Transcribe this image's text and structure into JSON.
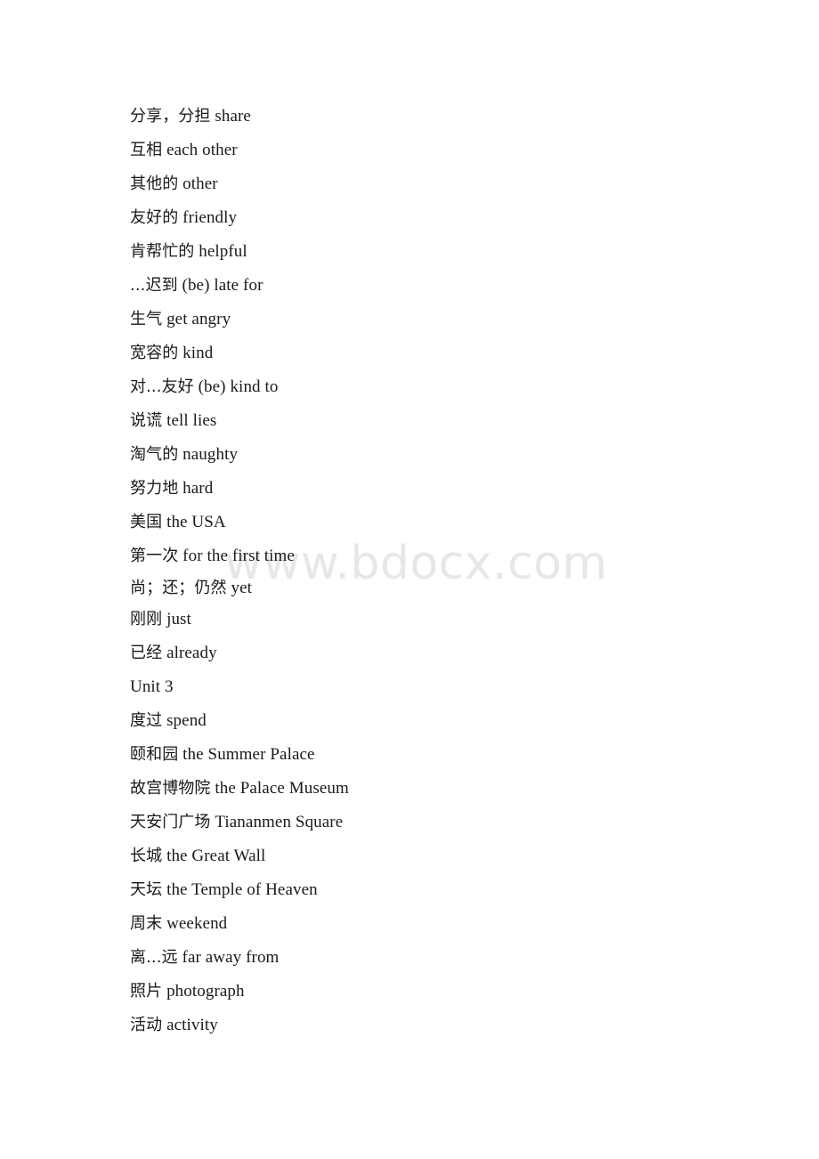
{
  "document": {
    "watermark": "www.bdocx.com",
    "watermark_color": "#e7e7e7",
    "text_color": "#1a1a1a",
    "background_color": "#ffffff",
    "lines": [
      {
        "cn": "分享，分担",
        "en": "share"
      },
      {
        "cn": "互相",
        "en": "each other"
      },
      {
        "cn": "其他的",
        "en": "other"
      },
      {
        "cn": "友好的",
        "en": "friendly"
      },
      {
        "cn": "肯帮忙的",
        "en": "helpful"
      },
      {
        "cn": "...迟到",
        "en": "(be) late for"
      },
      {
        "cn": "生气",
        "en": "get angry"
      },
      {
        "cn": "宽容的",
        "en": "kind"
      },
      {
        "cn": "对...友好",
        "en": "(be) kind to"
      },
      {
        "cn": "说谎",
        "en": "tell lies"
      },
      {
        "cn": "淘气的",
        "en": "naughty"
      },
      {
        "cn": "努力地",
        "en": "hard"
      },
      {
        "cn": "美国",
        "en": "the USA"
      },
      {
        "cn": "第一次",
        "en": "for the first time"
      },
      {
        "cn": "尚；还；仍然",
        "en": "yet",
        "tight": true
      },
      {
        "cn": "刚刚",
        "en": "just"
      },
      {
        "cn": "已经",
        "en": "already"
      },
      {
        "cn": "",
        "en": "Unit 3",
        "heading": true
      },
      {
        "cn": "度过",
        "en": "spend"
      },
      {
        "cn": "颐和园",
        "en": "the Summer Palace"
      },
      {
        "cn": "故宫博物院",
        "en": "the Palace Museum"
      },
      {
        "cn": "天安门广场",
        "en": "Tiananmen Square"
      },
      {
        "cn": "长城",
        "en": "the Great Wall"
      },
      {
        "cn": "天坛",
        "en": "the Temple of Heaven"
      },
      {
        "cn": "周末",
        "en": "weekend"
      },
      {
        "cn": "离...远",
        "en": "far away from"
      },
      {
        "cn": "照片",
        "en": "photograph"
      },
      {
        "cn": "活动",
        "en": "activity"
      }
    ]
  }
}
